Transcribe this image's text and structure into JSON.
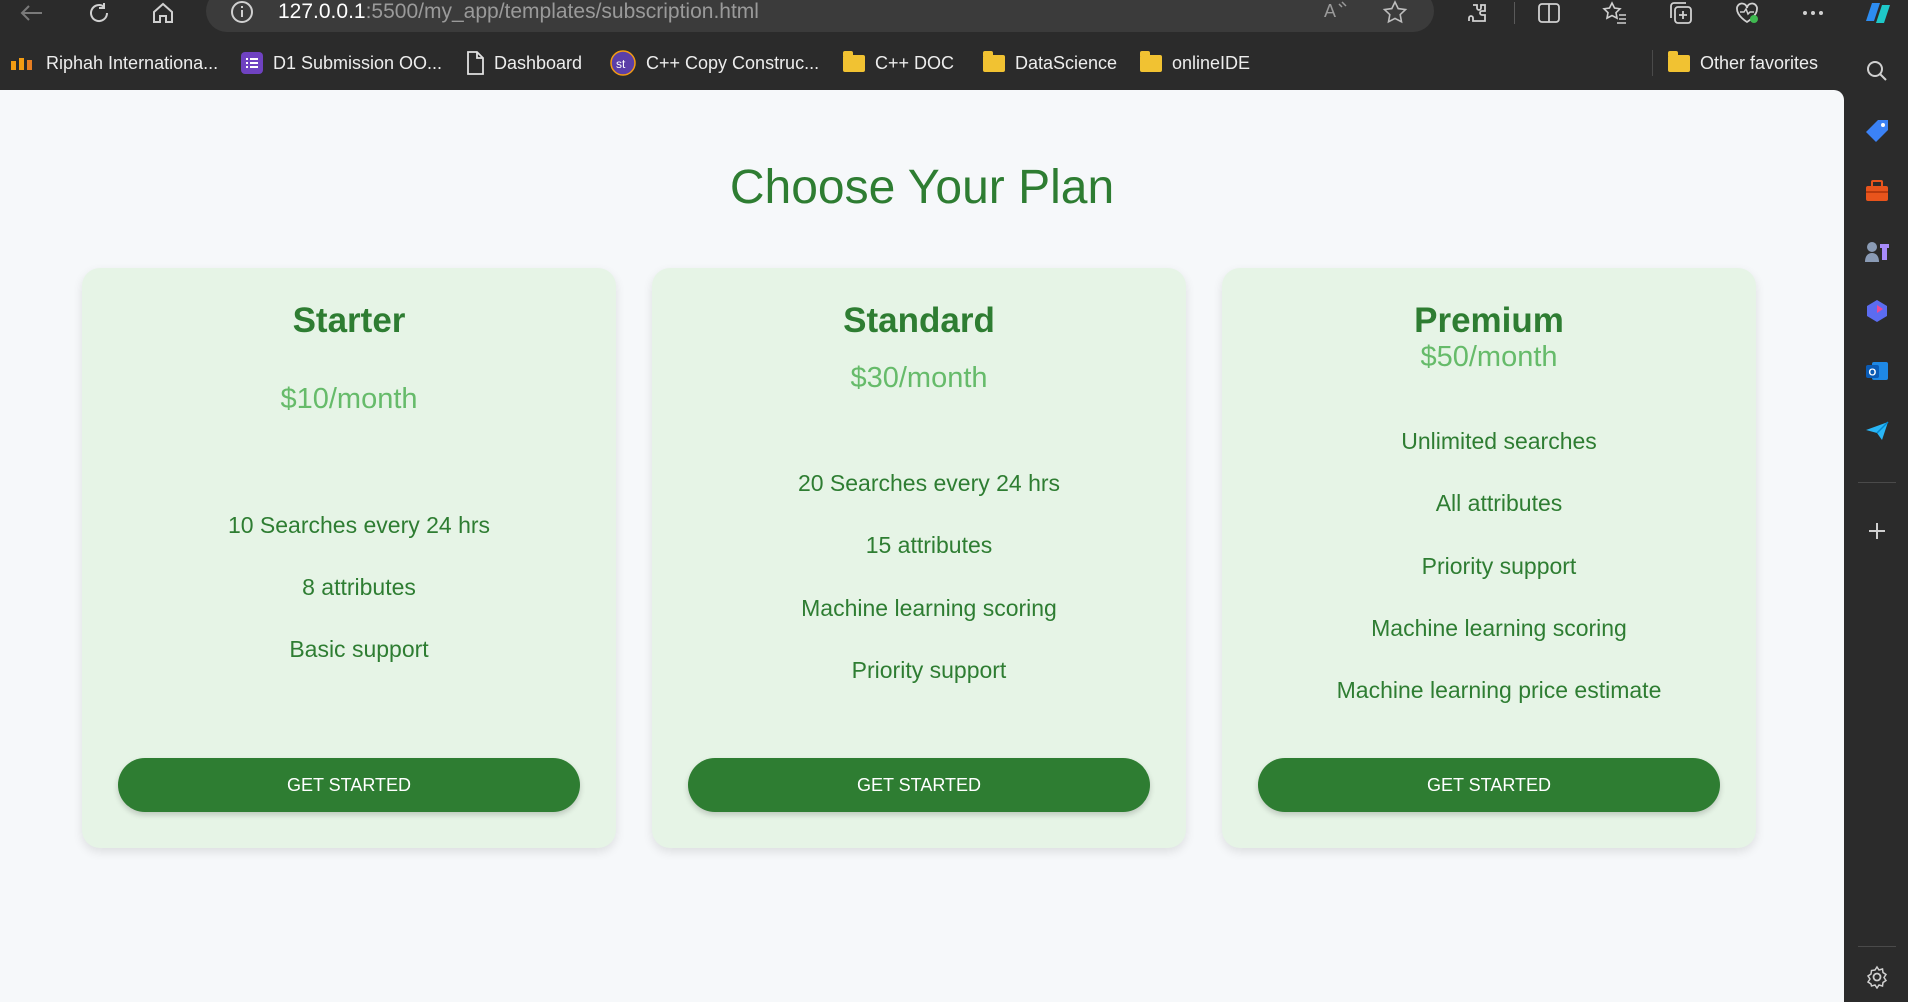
{
  "browser": {
    "address": {
      "host": "127.0.0.1",
      "path": ":5500/my_app/templates/subscription.html"
    },
    "favorites": [
      {
        "label": "Riphah Internationa...",
        "icon": "riphah-logo-icon"
      },
      {
        "label": "D1 Submission OO...",
        "icon": "list-icon"
      },
      {
        "label": "Dashboard",
        "icon": "page-icon"
      },
      {
        "label": "C++ Copy Construc...",
        "icon": "st-logo-icon"
      },
      {
        "label": "C++ DOC",
        "icon": "folder-icon"
      },
      {
        "label": "DataScience",
        "icon": "folder-icon"
      },
      {
        "label": "onlineIDE",
        "icon": "folder-icon"
      }
    ],
    "other_favorites": "Other favorites"
  },
  "page": {
    "title": "Choose Your Plan",
    "plans": [
      {
        "name": "Starter",
        "price": "$10/month",
        "features": [
          "10 Searches every 24 hrs",
          "8 attributes",
          "Basic support"
        ],
        "button": "GET STARTED"
      },
      {
        "name": "Standard",
        "price": "$30/month",
        "features": [
          "20 Searches every 24 hrs",
          "15 attributes",
          "Machine learning scoring",
          "Priority support"
        ],
        "button": "GET STARTED"
      },
      {
        "name": "Premium",
        "price": "$50/month",
        "features": [
          "Unlimited searches",
          "All attributes",
          "Priority support",
          "Machine learning scoring",
          "Machine learning price estimate"
        ],
        "button": "GET STARTED"
      }
    ]
  },
  "colors": {
    "accent": "#2e7d32",
    "price": "#66bb6a",
    "card_bg": "#e6f4e6",
    "page_bg": "#f6f8fa"
  }
}
